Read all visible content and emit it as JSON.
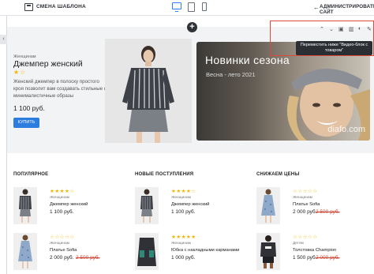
{
  "topbar": {
    "template_label": "СМЕНА ШАБЛОНА",
    "admin_label": "АДМИНИСТРИРОВАТЬ САЙТ",
    "admin_icon": "←"
  },
  "leftbar": {
    "tab_icon": "‹"
  },
  "add_block_icon": "+",
  "featured": {
    "category": "Женщинам",
    "title": "Джемпер женский",
    "stars": "★☆",
    "description": "Женский джемпер в полоску простого кроя позволит вам создавать стильные и минималистичные образы",
    "price": "1 100 руб.",
    "buy_label": "КУПИТЬ"
  },
  "banner": {
    "title": "Новинки сезона",
    "subtitle": "Весна - лето 2021",
    "watermark": "diafo.com"
  },
  "block_tools": {
    "tooltip": "Переместить ниже \"Видео-блок с товаром\""
  },
  "sections": [
    {
      "heading": "ПОПУЛЯРНОЕ",
      "items": [
        {
          "stars": "★★★★☆",
          "category": "Женщинам",
          "name": "Джемпер женский",
          "price": "1 100 руб.",
          "old_price": ""
        },
        {
          "stars": "☆☆☆☆☆",
          "category": "Женщинам",
          "name": "Платье Sofia",
          "price": "2 000 руб.",
          "old_price": "2 500 руб."
        }
      ]
    },
    {
      "heading": "НОВЫЕ ПОСТУПЛЕНИЯ",
      "items": [
        {
          "stars": "★★★★☆",
          "category": "Женщинам",
          "name": "Джемпер женский",
          "price": "1 100 руб.",
          "old_price": ""
        },
        {
          "stars": "★★★★★",
          "category": "Женщинам",
          "name": "Юбка с накладными карманами",
          "price": "1 000 руб.",
          "old_price": ""
        }
      ]
    },
    {
      "heading": "СНИЖАЕМ ЦЕНЫ",
      "items": [
        {
          "stars": "☆☆☆☆☆",
          "category": "Женщинам",
          "name": "Платье Sofia",
          "price": "2 000 руб.",
          "old_price": "2 500 руб."
        },
        {
          "stars": "☆☆☆☆☆",
          "category": "Детям",
          "name": "Толстовка Champion",
          "price": "1 500 руб.",
          "old_price": "2 000 руб."
        }
      ]
    }
  ],
  "colors": {
    "accent": "#2b7de0",
    "star": "#f2b600",
    "old_price": "#d04030",
    "selection": "#e04a3a"
  }
}
